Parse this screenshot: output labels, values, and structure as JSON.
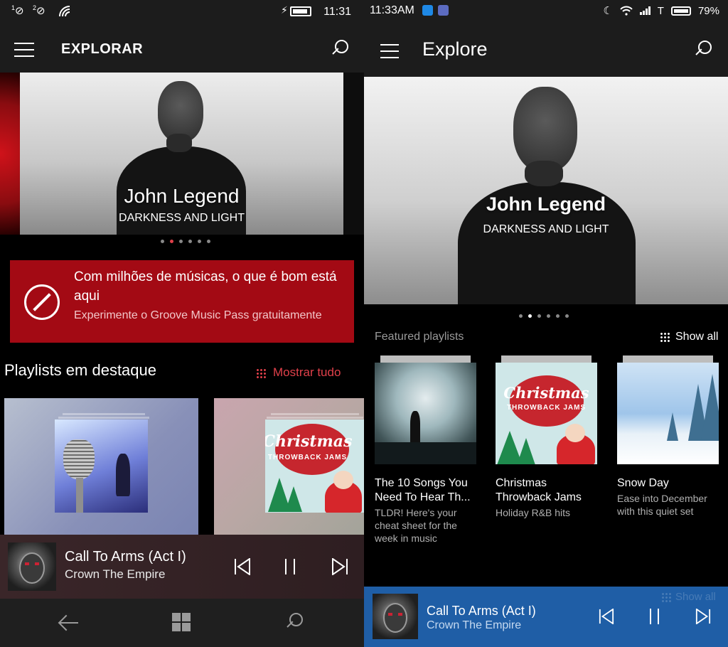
{
  "left": {
    "status": {
      "sim1": "1",
      "sim2": "2",
      "time": "11:31"
    },
    "header": {
      "title": "EXPLORAR",
      "menu_icon": "hamburger-icon",
      "search_icon": "search-icon"
    },
    "hero": {
      "title": "John Legend",
      "subtitle": "DARKNESS AND LIGHT",
      "page_count": 6,
      "active_index": 1
    },
    "promo": {
      "title": "Com milhões de músicas, o que é bom está aqui",
      "subtitle": "Experimente o Groove Music Pass gratuitamente",
      "background": "#a30a14",
      "icon": "compass-icon"
    },
    "section": {
      "title": "Playlists em destaque",
      "show_all": "Mostrar tudo",
      "accent": "#e0404a"
    },
    "tiles": [
      {
        "icon": "microphone-cover"
      },
      {
        "cover_title": "Christmas",
        "cover_subtitle": "THROWBACK JAMS"
      }
    ],
    "player": {
      "track": "Call To Arms (Act I)",
      "artist": "Crown The Empire"
    },
    "nav": {
      "back_icon": "back-arrow-icon",
      "home_icon": "windows-logo-icon",
      "search_icon": "search-icon"
    }
  },
  "right": {
    "status": {
      "time": "11:33AM",
      "carrier": "T",
      "battery": "79%"
    },
    "header": {
      "title": "Explore",
      "menu_icon": "hamburger-icon",
      "search_icon": "search-icon"
    },
    "hero": {
      "title": "John Legend",
      "subtitle": "DARKNESS AND LIGHT",
      "page_count": 6,
      "active_index": 1
    },
    "section": {
      "title": "Featured playlists",
      "show_all": "Show all"
    },
    "playlists": [
      {
        "title": "The 10 Songs You Need To Hear Th...",
        "description": "TLDR! Here's your cheat sheet for the week in music"
      },
      {
        "title": "Christmas Throwback Jams",
        "description": "Holiday R&B hits",
        "cover_title": "Christmas",
        "cover_subtitle": "THROWBACK JAMS"
      },
      {
        "title": "Snow Day",
        "description": "Ease into December with this quiet set"
      }
    ],
    "player": {
      "track": "Call To Arms (Act I)",
      "artist": "Crown The Empire",
      "ghost_show_all": "Show all",
      "background": "#1f5ea6"
    }
  }
}
